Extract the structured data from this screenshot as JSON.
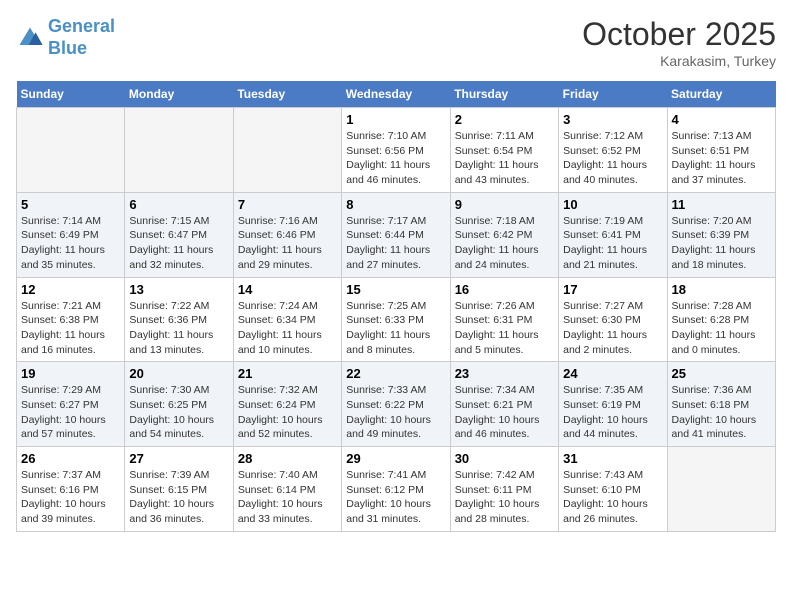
{
  "header": {
    "logo_line1": "General",
    "logo_line2": "Blue",
    "month": "October 2025",
    "location": "Karakasim, Turkey"
  },
  "weekdays": [
    "Sunday",
    "Monday",
    "Tuesday",
    "Wednesday",
    "Thursday",
    "Friday",
    "Saturday"
  ],
  "weeks": [
    [
      {
        "day": "",
        "info": ""
      },
      {
        "day": "",
        "info": ""
      },
      {
        "day": "",
        "info": ""
      },
      {
        "day": "1",
        "info": "Sunrise: 7:10 AM\nSunset: 6:56 PM\nDaylight: 11 hours and 46 minutes."
      },
      {
        "day": "2",
        "info": "Sunrise: 7:11 AM\nSunset: 6:54 PM\nDaylight: 11 hours and 43 minutes."
      },
      {
        "day": "3",
        "info": "Sunrise: 7:12 AM\nSunset: 6:52 PM\nDaylight: 11 hours and 40 minutes."
      },
      {
        "day": "4",
        "info": "Sunrise: 7:13 AM\nSunset: 6:51 PM\nDaylight: 11 hours and 37 minutes."
      }
    ],
    [
      {
        "day": "5",
        "info": "Sunrise: 7:14 AM\nSunset: 6:49 PM\nDaylight: 11 hours and 35 minutes."
      },
      {
        "day": "6",
        "info": "Sunrise: 7:15 AM\nSunset: 6:47 PM\nDaylight: 11 hours and 32 minutes."
      },
      {
        "day": "7",
        "info": "Sunrise: 7:16 AM\nSunset: 6:46 PM\nDaylight: 11 hours and 29 minutes."
      },
      {
        "day": "8",
        "info": "Sunrise: 7:17 AM\nSunset: 6:44 PM\nDaylight: 11 hours and 27 minutes."
      },
      {
        "day": "9",
        "info": "Sunrise: 7:18 AM\nSunset: 6:42 PM\nDaylight: 11 hours and 24 minutes."
      },
      {
        "day": "10",
        "info": "Sunrise: 7:19 AM\nSunset: 6:41 PM\nDaylight: 11 hours and 21 minutes."
      },
      {
        "day": "11",
        "info": "Sunrise: 7:20 AM\nSunset: 6:39 PM\nDaylight: 11 hours and 18 minutes."
      }
    ],
    [
      {
        "day": "12",
        "info": "Sunrise: 7:21 AM\nSunset: 6:38 PM\nDaylight: 11 hours and 16 minutes."
      },
      {
        "day": "13",
        "info": "Sunrise: 7:22 AM\nSunset: 6:36 PM\nDaylight: 11 hours and 13 minutes."
      },
      {
        "day": "14",
        "info": "Sunrise: 7:24 AM\nSunset: 6:34 PM\nDaylight: 11 hours and 10 minutes."
      },
      {
        "day": "15",
        "info": "Sunrise: 7:25 AM\nSunset: 6:33 PM\nDaylight: 11 hours and 8 minutes."
      },
      {
        "day": "16",
        "info": "Sunrise: 7:26 AM\nSunset: 6:31 PM\nDaylight: 11 hours and 5 minutes."
      },
      {
        "day": "17",
        "info": "Sunrise: 7:27 AM\nSunset: 6:30 PM\nDaylight: 11 hours and 2 minutes."
      },
      {
        "day": "18",
        "info": "Sunrise: 7:28 AM\nSunset: 6:28 PM\nDaylight: 11 hours and 0 minutes."
      }
    ],
    [
      {
        "day": "19",
        "info": "Sunrise: 7:29 AM\nSunset: 6:27 PM\nDaylight: 10 hours and 57 minutes."
      },
      {
        "day": "20",
        "info": "Sunrise: 7:30 AM\nSunset: 6:25 PM\nDaylight: 10 hours and 54 minutes."
      },
      {
        "day": "21",
        "info": "Sunrise: 7:32 AM\nSunset: 6:24 PM\nDaylight: 10 hours and 52 minutes."
      },
      {
        "day": "22",
        "info": "Sunrise: 7:33 AM\nSunset: 6:22 PM\nDaylight: 10 hours and 49 minutes."
      },
      {
        "day": "23",
        "info": "Sunrise: 7:34 AM\nSunset: 6:21 PM\nDaylight: 10 hours and 46 minutes."
      },
      {
        "day": "24",
        "info": "Sunrise: 7:35 AM\nSunset: 6:19 PM\nDaylight: 10 hours and 44 minutes."
      },
      {
        "day": "25",
        "info": "Sunrise: 7:36 AM\nSunset: 6:18 PM\nDaylight: 10 hours and 41 minutes."
      }
    ],
    [
      {
        "day": "26",
        "info": "Sunrise: 7:37 AM\nSunset: 6:16 PM\nDaylight: 10 hours and 39 minutes."
      },
      {
        "day": "27",
        "info": "Sunrise: 7:39 AM\nSunset: 6:15 PM\nDaylight: 10 hours and 36 minutes."
      },
      {
        "day": "28",
        "info": "Sunrise: 7:40 AM\nSunset: 6:14 PM\nDaylight: 10 hours and 33 minutes."
      },
      {
        "day": "29",
        "info": "Sunrise: 7:41 AM\nSunset: 6:12 PM\nDaylight: 10 hours and 31 minutes."
      },
      {
        "day": "30",
        "info": "Sunrise: 7:42 AM\nSunset: 6:11 PM\nDaylight: 10 hours and 28 minutes."
      },
      {
        "day": "31",
        "info": "Sunrise: 7:43 AM\nSunset: 6:10 PM\nDaylight: 10 hours and 26 minutes."
      },
      {
        "day": "",
        "info": ""
      }
    ]
  ]
}
